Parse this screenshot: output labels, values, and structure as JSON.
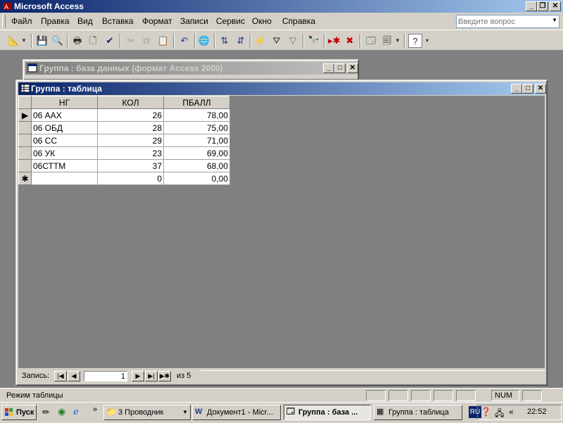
{
  "app": {
    "title": "Microsoft Access",
    "ask_placeholder": "Введите вопрос"
  },
  "menu": [
    "Файл",
    "Правка",
    "Вид",
    "Вставка",
    "Формат",
    "Записи",
    "Сервис",
    "Окно",
    "Справка"
  ],
  "db_window": {
    "title": "Группа : база данных (формат Access 2000)"
  },
  "table_window": {
    "title": "Группа : таблица",
    "columns": [
      "НГ",
      "КОЛ",
      "ПБАЛЛ"
    ],
    "rows": [
      [
        "06 ААХ",
        "26",
        "78,00"
      ],
      [
        "06 ОБД",
        "28",
        "75,00"
      ],
      [
        "06 СС",
        "29",
        "71,00"
      ],
      [
        "06 УК",
        "23",
        "69,00"
      ],
      [
        "06СТТМ",
        "37",
        "68,00"
      ]
    ],
    "new_row": [
      "",
      "0",
      "0,00"
    ],
    "record_marker": "▶",
    "new_marker": "✱",
    "nav": {
      "label": "Запись:",
      "current": "1",
      "of_label": "из 5"
    }
  },
  "status": {
    "mode": "Режим таблицы",
    "num": "NUM"
  },
  "taskbar": {
    "start": "Пуск",
    "buttons": [
      "3 Проводник",
      "Документ1 - Micr...",
      "Группа : база ...",
      "Группа : таблица"
    ],
    "lang": "RU",
    "clock": "22:52"
  }
}
